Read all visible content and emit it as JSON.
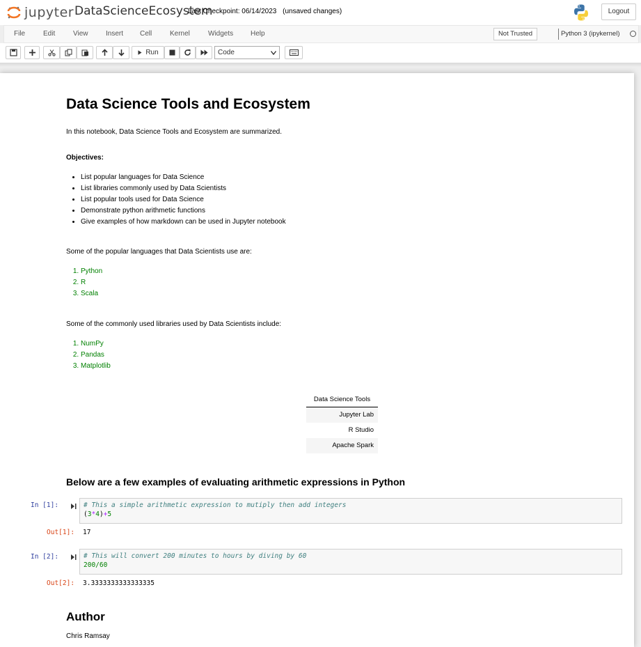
{
  "header": {
    "logo_text": "jupyter",
    "notebook_title": "DataScienceEcosystem",
    "checkpoint": "Last Checkpoint: 06/14/2023",
    "save_status": "(unsaved changes)",
    "logout_label": "Logout"
  },
  "menubar": {
    "items": [
      "File",
      "Edit",
      "View",
      "Insert",
      "Cell",
      "Kernel",
      "Widgets",
      "Help"
    ],
    "trust_label": "Not Trusted",
    "kernel_name": "Python 3 (ipykernel)"
  },
  "toolbar": {
    "run_label": "Run",
    "cell_type": "Code"
  },
  "notebook": {
    "title": "Data Science Tools and Ecosystem",
    "intro": "In this notebook, Data Science Tools and Ecosystem are summarized.",
    "objectives_label": "Objectives:",
    "objectives": [
      "List popular languages for Data Science",
      "List libraries commonly used by Data Scientists",
      "List popular tools used for Data Science",
      "Demonstrate python arithmetic functions",
      "Give examples of how markdown can be used in Jupyter notebook"
    ],
    "languages_intro": "Some of the popular languages that Data Scientists use are:",
    "languages": [
      "Python",
      "R",
      "Scala"
    ],
    "libraries_intro": "Some of the commonly used libraries used by Data Scientists include:",
    "libraries": [
      "NumPy",
      "Pandas",
      "Matplotlib"
    ],
    "tools_table": {
      "header": "Data Science Tools",
      "rows": [
        "Jupyter Lab",
        "R Studio",
        "Apache Spark"
      ]
    },
    "examples_heading": "Below are a few examples of evaluating arithmetic expressions in Python",
    "cells": [
      {
        "in_prompt": "In [1]:",
        "comment": "# This a simple arithmetic expression to mutiply then add integers",
        "code": "(3*4)+5",
        "out_prompt": "Out[1]:",
        "output": "17"
      },
      {
        "in_prompt": "In [2]:",
        "comment": "# This will convert 200 minutes to hours by diving by 60",
        "code": "200/60",
        "out_prompt": "Out[2]:",
        "output": "3.3333333333333335"
      }
    ],
    "author_heading": "Author",
    "author_name": "Chris Ramsay"
  }
}
